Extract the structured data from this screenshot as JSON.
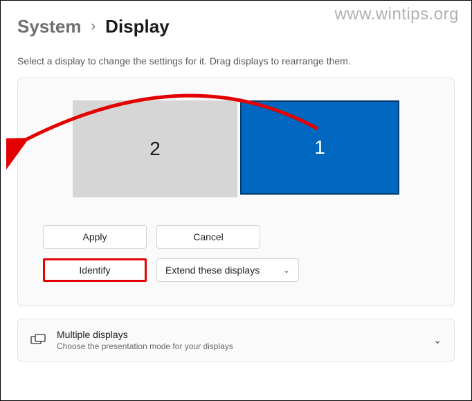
{
  "watermark": "www.wintips.org",
  "breadcrumb": {
    "parent": "System",
    "current": "Display"
  },
  "help_text": "Select a display to change the settings for it. Drag displays to rearrange them.",
  "displays": {
    "tile_left_label": "2",
    "tile_right_label": "1"
  },
  "buttons": {
    "apply": "Apply",
    "cancel": "Cancel",
    "identify": "Identify"
  },
  "dropdown": {
    "selected": "Extend these displays"
  },
  "multiple_displays": {
    "title": "Multiple displays",
    "subtitle": "Choose the presentation mode for your displays"
  }
}
